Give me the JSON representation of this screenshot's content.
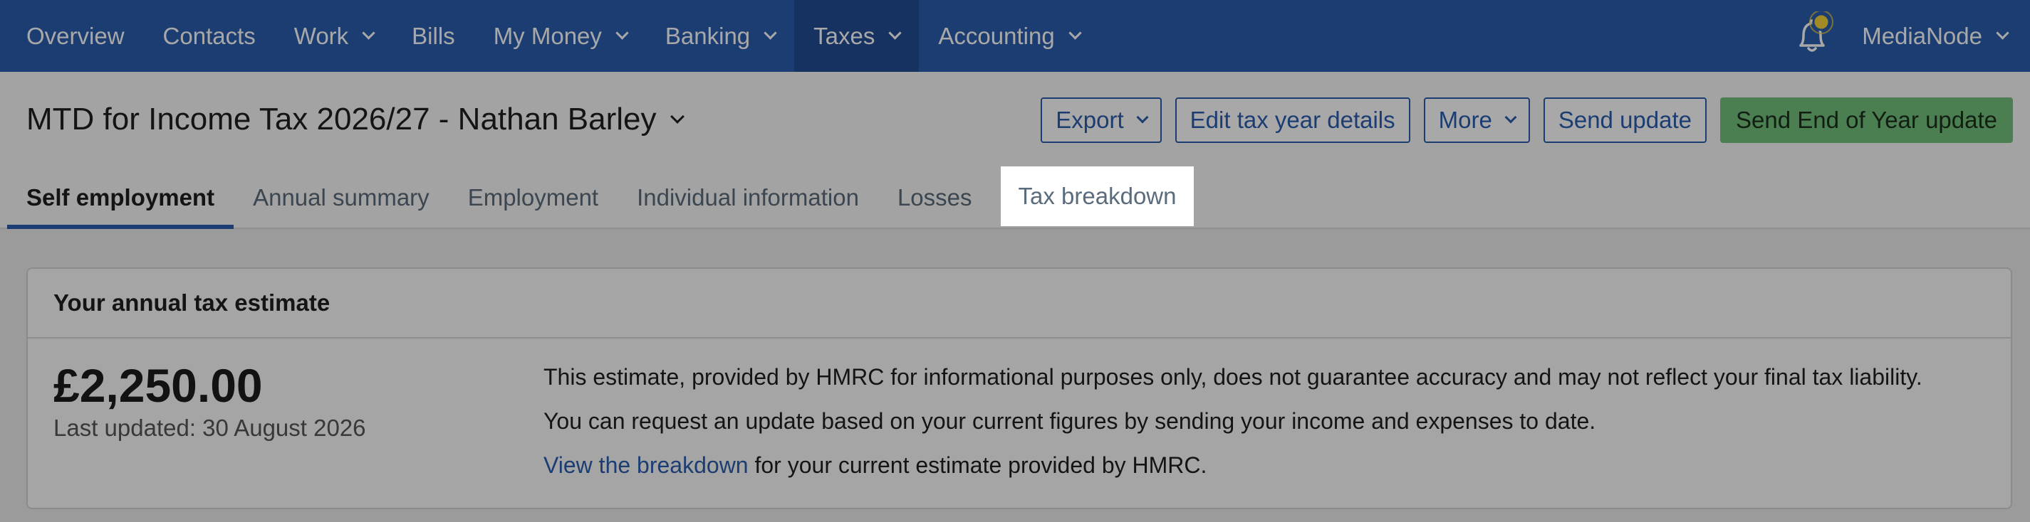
{
  "nav": {
    "items": [
      {
        "label": "Overview",
        "dropdown": false
      },
      {
        "label": "Contacts",
        "dropdown": false
      },
      {
        "label": "Work",
        "dropdown": true
      },
      {
        "label": "Bills",
        "dropdown": false
      },
      {
        "label": "My Money",
        "dropdown": true
      },
      {
        "label": "Banking",
        "dropdown": true
      },
      {
        "label": "Taxes",
        "dropdown": true
      },
      {
        "label": "Accounting",
        "dropdown": true
      }
    ],
    "active": "Taxes",
    "user": "MediaNode"
  },
  "header": {
    "title": "MTD for Income Tax 2026/27 - Nathan Barley",
    "buttons": {
      "export": "Export",
      "edit": "Edit tax year details",
      "more": "More",
      "send_update": "Send update",
      "send_eoy": "Send End of Year update"
    }
  },
  "tabs": [
    "Self employment",
    "Annual summary",
    "Employment",
    "Individual information",
    "Losses",
    "Tax breakdown"
  ],
  "active_tab": "Self employment",
  "highlighted_tab": "Tax breakdown",
  "card": {
    "heading": "Your annual tax estimate",
    "amount": "£2,250.00",
    "updated": "Last updated: 30 August 2026",
    "line1": "This estimate, provided by HMRC for informational purposes only, does not guarantee accuracy and may not reflect your final tax liability.",
    "line2": "You can request an update based on your current figures by sending your income and expenses to date.",
    "link": "View the breakdown",
    "line3_rest": " for your current estimate provided by HMRC."
  },
  "colors": {
    "nav_bg": "#2b5dae",
    "nav_active": "#214c94",
    "primary_button": "#73c07a",
    "link": "#2b5dae",
    "notification_dot": "#f3d33a"
  }
}
